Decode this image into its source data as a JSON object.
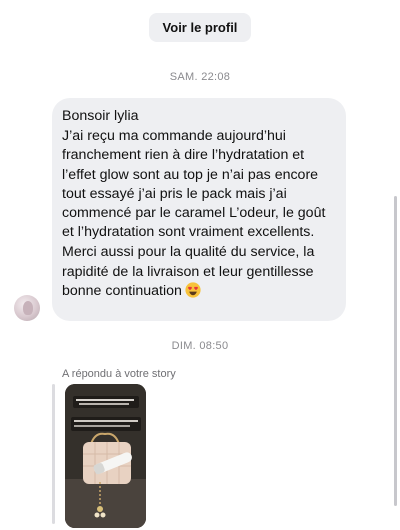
{
  "header": {
    "profile_button": "Voir le profil"
  },
  "timestamps": {
    "first": "SAM. 22:08",
    "second": "DIM. 08:50"
  },
  "message": {
    "paragraphs": [
      "Bonsoir lylia",
      "J’ai reçu ma commande aujourd’hui franchement rien à dire l’hydratation et l’effet glow sont au top je n’ai pas encore tout essayé j’ai pris le pack mais j’ai commencé par le caramel L’odeur, le goût et l’hydratation sont vraiment excellents.",
      "Merci aussi pour la qualité du service, la rapidité de la livraison et leur gentillesse bonne continuation"
    ],
    "emoji": "heart-eyes-emoji"
  },
  "reply": {
    "label": "A répondu à votre story"
  },
  "colors": {
    "bubble_bg": "#eeeff2",
    "muted_text": "#8a8a8e",
    "emoji_face": "#f7c23b",
    "emoji_heart": "#e5323b"
  }
}
